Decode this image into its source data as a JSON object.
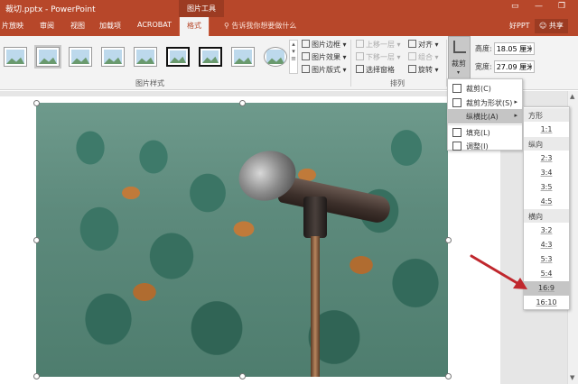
{
  "window": {
    "title": "裁切.pptx - PowerPoint",
    "context_tab": "图片工具",
    "min": "—",
    "restore": "❐",
    "ribbon_toggle": "▭"
  },
  "tabs": [
    "片放映",
    "审阅",
    "视图",
    "加载项",
    "ACROBAT",
    "格式"
  ],
  "tell_me": "告诉我你想要做什么",
  "user": "好PPT",
  "share": "共享",
  "ribbon": {
    "pic_styles_label": "图片样式",
    "arrange_label": "排列",
    "border": "图片边框",
    "effects": "图片效果",
    "layout": "图片版式",
    "bring_forward": "上移一层",
    "send_backward": "下移一层",
    "selection_pane": "选择窗格",
    "align": "对齐",
    "group": "组合",
    "rotate": "旋转",
    "crop": "裁剪",
    "height_label": "高度:",
    "height_value": "18.05 厘米",
    "width_label": "宽度:",
    "width_value": "27.09 厘米"
  },
  "crop_menu": {
    "crop": "裁剪(C)",
    "crop_to_shape": "裁剪为形状(S)",
    "aspect_ratio": "纵横比(A)",
    "fill": "填充(L)",
    "fit": "调整(I)"
  },
  "aspect_menu": {
    "square_header": "方形",
    "square": [
      "1:1"
    ],
    "portrait_header": "纵向",
    "portrait": [
      "2:3",
      "3:4",
      "3:5",
      "4:5"
    ],
    "landscape_header": "横向",
    "landscape": [
      "3:2",
      "4:3",
      "5:3",
      "5:4",
      "16:9",
      "16:10"
    ],
    "selected": "16:9"
  },
  "colors": {
    "accent": "#b7472a",
    "menu_highlight": "#c5c5c5",
    "arrow": "#c0272d"
  }
}
